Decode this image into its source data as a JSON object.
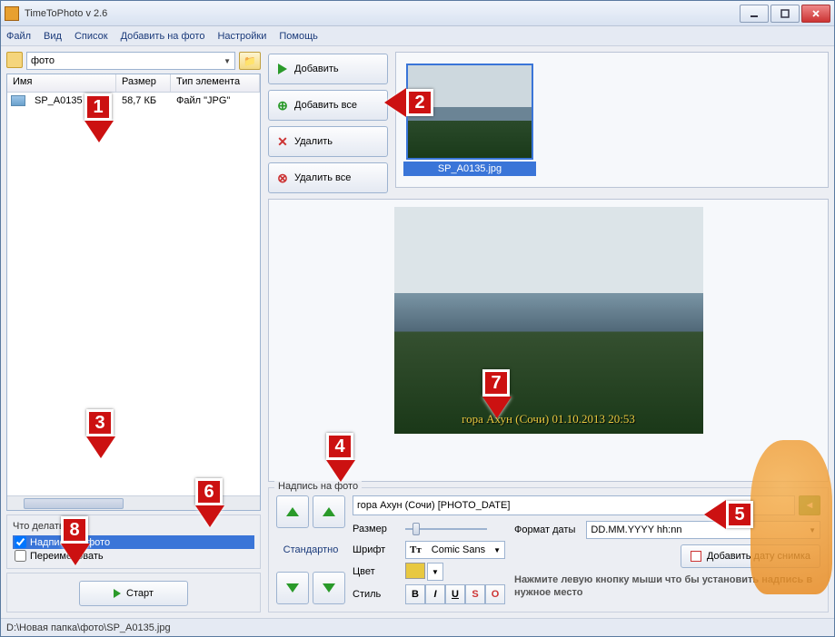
{
  "titlebar": {
    "title": "TimeToPhoto v 2.6"
  },
  "menubar": [
    "Файл",
    "Вид",
    "Список",
    "Добавить на фото",
    "Настройки",
    "Помощь"
  ],
  "path": {
    "folder": "фото"
  },
  "filelist": {
    "headers": {
      "name": "Имя",
      "size": "Размер",
      "type": "Тип элемента"
    },
    "rows": [
      {
        "name": "SP_A0135",
        "size": "58,7 КБ",
        "type": "Файл \"JPG\""
      }
    ]
  },
  "actionbox": {
    "legend": "Что делать:",
    "opt_caption": "Надпись на фото",
    "opt_rename": "Переименовать"
  },
  "start": "Старт",
  "mid": {
    "add": "Добавить",
    "addall": "Добавить все",
    "del": "Удалить",
    "delall": "Удалить все"
  },
  "thumb": {
    "label": "SP_A0135.jpg"
  },
  "preview": {
    "caption": "гора Ахун (Сочи) 01.10.2013 20:53"
  },
  "bottom": {
    "legend": "Надпись на фото",
    "standard": "Стандартно",
    "text_value": "гора Ахун (Сочи) [PHOTO_DATE]",
    "size": "Размер",
    "font": "Шрифт",
    "font_value": "Comic Sans",
    "color": "Цвет",
    "style": "Стиль",
    "dateformat": "Формат даты",
    "dateformat_value": "DD.MM.YYYY hh:nn",
    "adddate": "Добавить дату снимка",
    "hint": "Нажмите левую кнопку мыши что бы установить надпись в нужное место"
  },
  "statusbar": "D:\\Новая папка\\фото\\SP_A0135.jpg",
  "markers": [
    "1",
    "2",
    "3",
    "4",
    "5",
    "6",
    "7",
    "8"
  ]
}
